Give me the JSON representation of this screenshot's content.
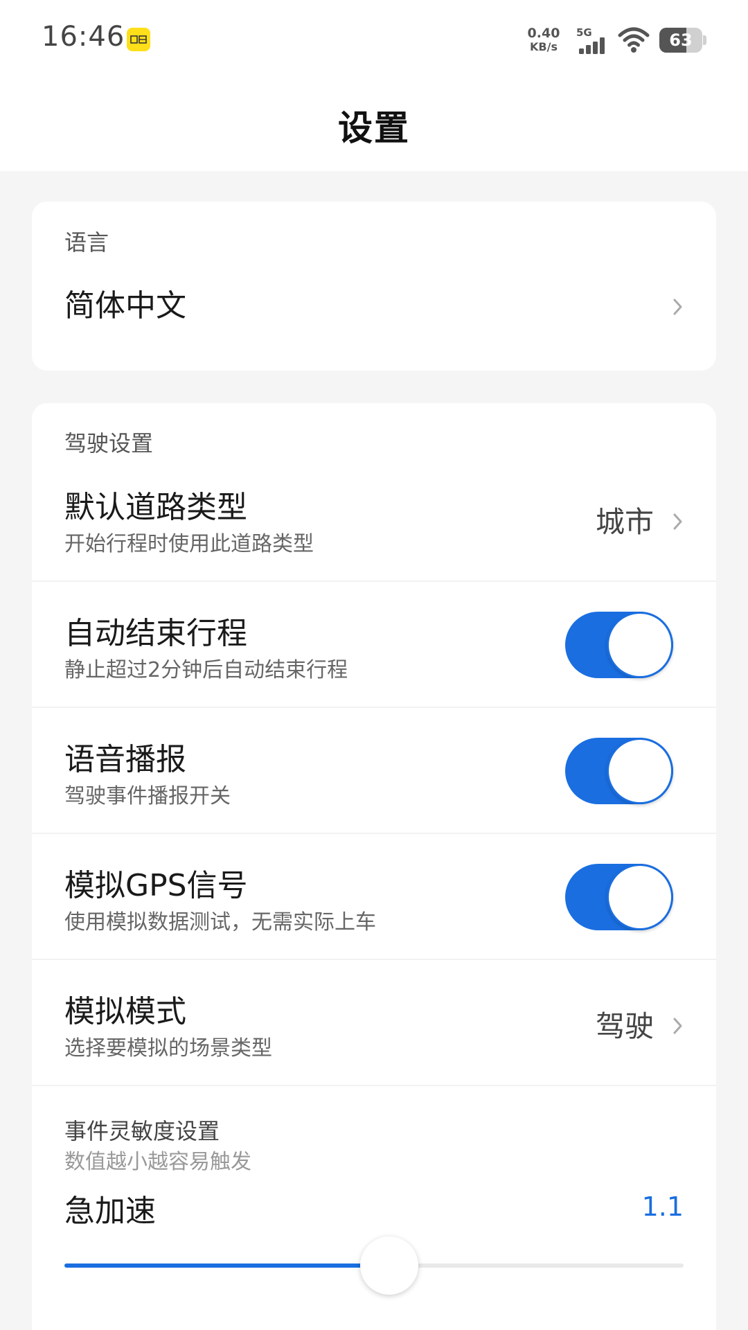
{
  "status_bar": {
    "time": "16:46",
    "app_icon": "yellow-app-icon",
    "net_speed_value": "0.40",
    "net_speed_unit": "KB/s",
    "network_type": "5G",
    "battery_percent": "63",
    "battery_level": 0.63
  },
  "header": {
    "title": "设置"
  },
  "language_section": {
    "header": "语言",
    "current_language": "简体中文"
  },
  "driving_section": {
    "header": "驾驶设置",
    "road_type": {
      "title": "默认道路类型",
      "subtitle": "开始行程时使用此道路类型",
      "value": "城市"
    },
    "auto_end_trip": {
      "title": "自动结束行程",
      "subtitle": "静止超过2分钟后自动结束行程",
      "enabled": true
    },
    "voice_broadcast": {
      "title": "语音播报",
      "subtitle": "驾驶事件播报开关",
      "enabled": true
    },
    "mock_gps": {
      "title": "模拟GPS信号",
      "subtitle": "使用模拟数据测试，无需实际上车",
      "enabled": true
    },
    "sim_mode": {
      "title": "模拟模式",
      "subtitle": "选择要模拟的场景类型",
      "value": "驾驶"
    },
    "sensitivity": {
      "header": "事件灵敏度设置",
      "hint": "数值越小越容易触发",
      "accel": {
        "title": "急加速",
        "value": "1.1",
        "slider_fraction": 0.525
      }
    }
  },
  "colors": {
    "accent": "#1a6ee0",
    "background": "#f5f5f5",
    "card": "#ffffff"
  }
}
